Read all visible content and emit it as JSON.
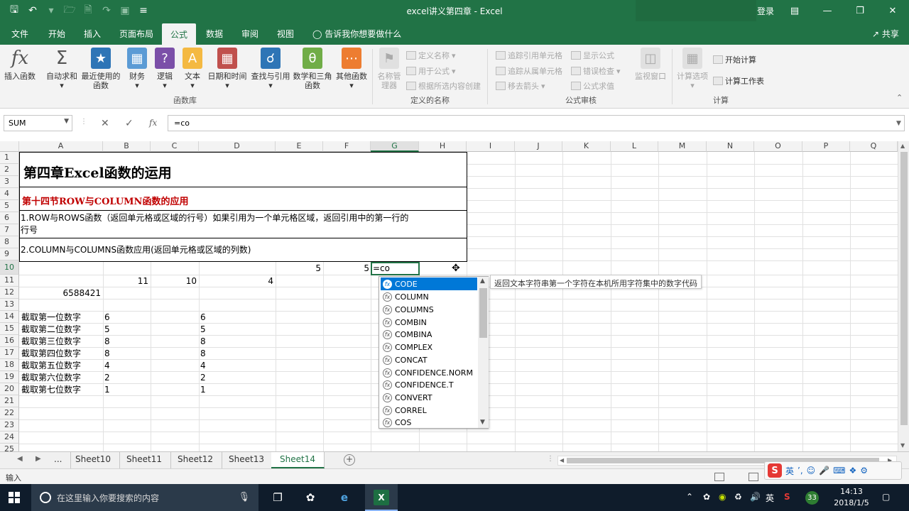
{
  "window": {
    "title": "excel讲义第四章  -  Excel",
    "login": "登录"
  },
  "tabs": [
    "文件",
    "开始",
    "插入",
    "页面布局",
    "公式",
    "数据",
    "审阅",
    "视图"
  ],
  "active_tab": "公式",
  "tell_me": "告诉我你想要做什么",
  "share": "共享",
  "ribbon": {
    "function_library": {
      "label": "函数库",
      "buttons": [
        "插入函数",
        "自动求和",
        "最近使用的函数",
        "财务",
        "逻辑",
        "文本",
        "日期和时间",
        "查找与引用",
        "数学和三角函数",
        "其他函数"
      ]
    },
    "defined_names": {
      "label": "定义的名称",
      "name_manager": "名称管理器",
      "items": [
        "定义名称",
        "用于公式",
        "根据所选内容创建"
      ]
    },
    "formula_auditing": {
      "label": "公式审核",
      "items": [
        "追踪引用单元格",
        "追踪从属单元格",
        "移去箭头",
        "显示公式",
        "错误检查",
        "公式求值"
      ],
      "watch": "监视窗口"
    },
    "calculation": {
      "label": "计算",
      "options": "计算选项",
      "items": [
        "开始计算",
        "计算工作表"
      ]
    }
  },
  "formula_bar": {
    "name_box": "SUM",
    "formula": "=co"
  },
  "grid": {
    "columns": [
      "A",
      "B",
      "C",
      "D",
      "E",
      "F",
      "G",
      "H",
      "I",
      "J",
      "K",
      "L",
      "M",
      "N",
      "O",
      "P",
      "Q"
    ],
    "rows": [
      "1",
      "2",
      "3",
      "4",
      "5",
      "6",
      "7",
      "8",
      "9",
      "10",
      "11",
      "12",
      "13",
      "14",
      "15",
      "16",
      "17",
      "18",
      "19",
      "20",
      "21",
      "22",
      "23",
      "24",
      "25"
    ],
    "selected_col": "G",
    "selected_row": "10",
    "chapter_title": "第四章Excel函数的运用",
    "section_title": "第十四节ROW与COLUMN函数的应用",
    "note1": "1.ROW与ROWS函数（返回单元格或区域的行号）如果引用为一个单元格区域，返回引用中的第一行的",
    "note1b": "行号",
    "note2": "2.COLUMN与COLUMNS函数应用(返回单元格或区域的列数)",
    "e10": "5",
    "f10": "5",
    "active_cell_text": "=co",
    "b11": "11",
    "c11": "10",
    "d11": "4",
    "a12": "6588421",
    "digit_rows": [
      {
        "label": "截取第一位数字",
        "b": "6",
        "d": "6"
      },
      {
        "label": "截取第二位数字",
        "b": "5",
        "d": "5"
      },
      {
        "label": "截取第三位数字",
        "b": "8",
        "d": "8"
      },
      {
        "label": "截取第四位数字",
        "b": "8",
        "d": "8"
      },
      {
        "label": "截取第五位数字",
        "b": "4",
        "d": "4"
      },
      {
        "label": "截取第六位数字",
        "b": "2",
        "d": "2"
      },
      {
        "label": "截取第七位数字",
        "b": "1",
        "d": "1"
      }
    ]
  },
  "autocomplete": {
    "items": [
      "CODE",
      "COLUMN",
      "COLUMNS",
      "COMBIN",
      "COMBINA",
      "COMPLEX",
      "CONCAT",
      "CONFIDENCE.NORM",
      "CONFIDENCE.T",
      "CONVERT",
      "CORREL",
      "COS"
    ],
    "highlighted": "CODE",
    "tooltip": "返回文本字符串第一个字符在本机所用字符集中的数字代码"
  },
  "sheets": [
    "...",
    "Sheet10",
    "Sheet11",
    "Sheet12",
    "Sheet13",
    "Sheet14"
  ],
  "active_sheet": "Sheet14",
  "status": {
    "mode": "输入",
    "ime_lang": "英"
  },
  "taskbar": {
    "search_placeholder": "在这里输入你要搜索的内容",
    "time": "14:13",
    "date": "2018/1/5",
    "ime": "英",
    "badge": "33"
  },
  "colors": {
    "excel_green": "#217346",
    "highlight": "#0078d7",
    "red_title": "#c00000"
  }
}
